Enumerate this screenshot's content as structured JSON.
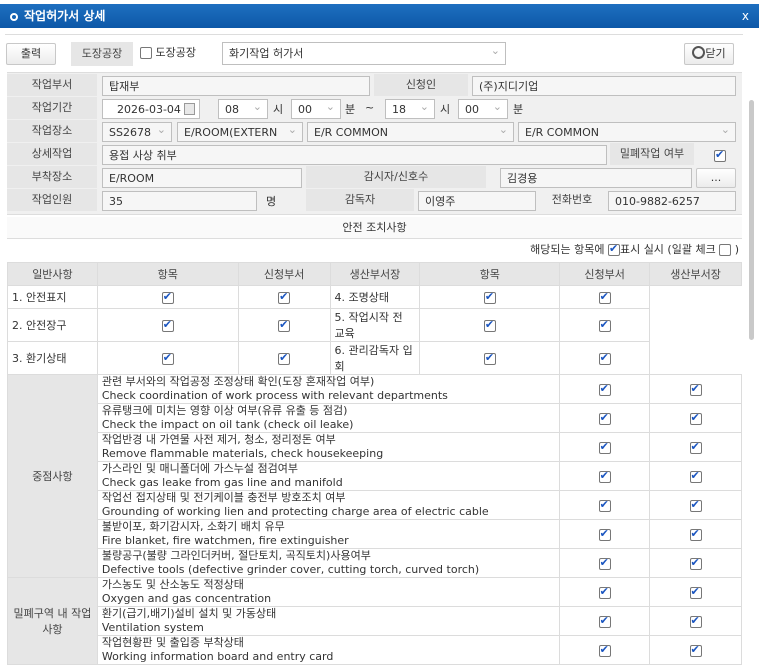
{
  "window": {
    "title": "작업허가서 상세",
    "close": "x"
  },
  "toolbar": {
    "print": "출력",
    "factory_label": "도장공장",
    "factory_check_label": "도장공장",
    "permit_type": "화기작업 허가서",
    "close": "닫기"
  },
  "form": {
    "dept_label": "작업부서",
    "dept": "탑재부",
    "applicant_label": "신청인",
    "applicant": "(주)지디기업",
    "period_label": "작업기간",
    "date": "2026-03-04",
    "start_hour": "08",
    "hour_unit": "시",
    "start_min": "00",
    "min_unit": "분",
    "tilde": "~",
    "end_hour": "18",
    "end_min": "00",
    "place_label": "작업장소",
    "place1": "SS2678",
    "place2": "E/ROOM(EXTERN",
    "place3": "E/R COMMON",
    "place4": "E/R COMMON",
    "detail_label": "상세작업",
    "detail": "용접 사상 취부",
    "confined_label": "밀폐작업 여부",
    "attach_label": "부착장소",
    "attach": "E/ROOM",
    "watcher_label": "감시자/신호수",
    "watcher": "김경용",
    "more": "...",
    "workers_label": "작업인원",
    "workers": "35",
    "workers_unit": "명",
    "supervisor_label": "감독자",
    "supervisor": "이영주",
    "phone_label": "전화번호",
    "phone": "010-9882-6257"
  },
  "safety": {
    "title": "안전 조치사항",
    "note1": "해당되는 항목에",
    "note2": "표시 실시 (일괄 체크",
    "note3": ")",
    "headers": [
      "항목",
      "신청부서",
      "생산부서장",
      "항목",
      "신청부서",
      "생산부서장"
    ],
    "general_label": "일반사항",
    "general": [
      [
        "1. 안전표지",
        "4. 조명상태"
      ],
      [
        "2. 안전장구",
        "5. 작업시작 전 교육"
      ],
      [
        "3. 환기상태",
        "6. 관리감독자 입회"
      ]
    ],
    "focus_label": "중점사항",
    "focus": [
      {
        "ko": "관련 부서와의 작업공정 조정상태 확인(도장 혼재작업 여부)",
        "en": "Check coordination of work process with relevant departments"
      },
      {
        "ko": "유류탱크에 미치는 영향 이상 여부(유류 유출 등 점검)",
        "en": "Check the impact on oil tank (check oil leake)"
      },
      {
        "ko": "작업반경 내 가연물 사전 제거, 청소, 정리정돈 여부",
        "en": "Remove flammable materials, check housekeeping"
      },
      {
        "ko": "가스라인 및 매니폴더에 가스누설 점검여부",
        "en": "Check gas leake from gas line and manifold"
      },
      {
        "ko": "작업선 접지상태 및 전기케이블 충전부 방호조치 여부",
        "en": "Grounding of working lien and protecting charge area of electric cable"
      },
      {
        "ko": "불받이포, 화기감시자, 소화기 배치 유무",
        "en": "Fire blanket, fire watchmen, fire extinguisher"
      },
      {
        "ko": "불량공구(불량 그라인더커버, 절단토치, 곡직토치)사용여부",
        "en": "Defective tools (defective grinder cover, cutting torch, curved torch)"
      }
    ],
    "confined_label": "밀폐구역 내 작업 사항",
    "confined": [
      {
        "ko": "가스농도 및 산소농도 적정상태",
        "en": "Oxygen and gas concentration"
      },
      {
        "ko": "환기(급기,배기)설비 설치 및 가동상태",
        "en": "Ventilation system"
      },
      {
        "ko": "작업현황판 및 출입증 부착상태",
        "en": "Working information board and entry card"
      }
    ]
  }
}
